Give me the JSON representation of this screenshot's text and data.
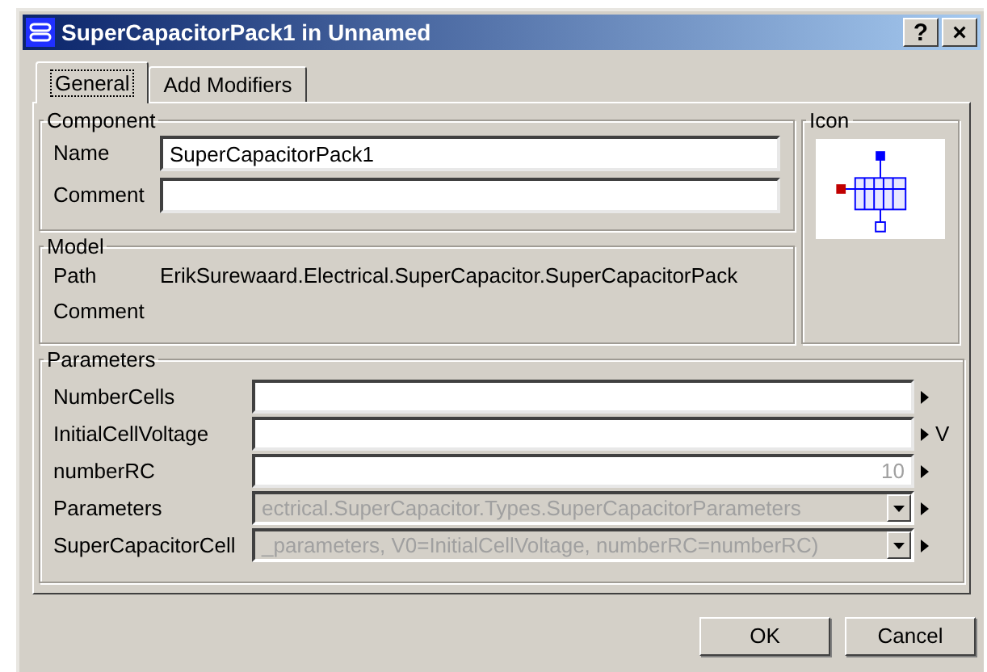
{
  "window": {
    "title": "SuperCapacitorPack1 in Unnamed",
    "buttons": [
      "?",
      "×"
    ]
  },
  "tabs": [
    {
      "label": "General",
      "selected": true
    },
    {
      "label": "Add Modifiers",
      "selected": false
    }
  ],
  "component": {
    "title": "Component",
    "fields": [
      {
        "label": "Name",
        "value": "SuperCapacitorPack1"
      },
      {
        "label": "Comment"
      }
    ]
  },
  "icon": {
    "title": "Icon"
  },
  "model": {
    "title": "Model",
    "rows": [
      {
        "label": "Path",
        "value": "ErikSurewaard.Electrical.SuperCapacitor.SuperCapacitorPack"
      },
      {
        "label": "Comment"
      }
    ]
  },
  "parameters": {
    "title": "Parameters",
    "rows": [
      {
        "kind": "text",
        "label": "NumberCells"
      },
      {
        "kind": "text",
        "label": "InitialCellVoltage",
        "unit": "V"
      },
      {
        "kind": "text",
        "label": "numberRC",
        "placeholder": "10"
      },
      {
        "kind": "combo",
        "label": "Parameters",
        "placeholder": "ectrical.SuperCapacitor.Types.SuperCapacitorParameters"
      },
      {
        "kind": "combo",
        "label": "SuperCapacitorCell",
        "placeholder": "_parameters, V0=InitialCellVoltage, numberRC=numberRC)"
      }
    ]
  },
  "buttons": [
    "OK",
    "Cancel"
  ]
}
